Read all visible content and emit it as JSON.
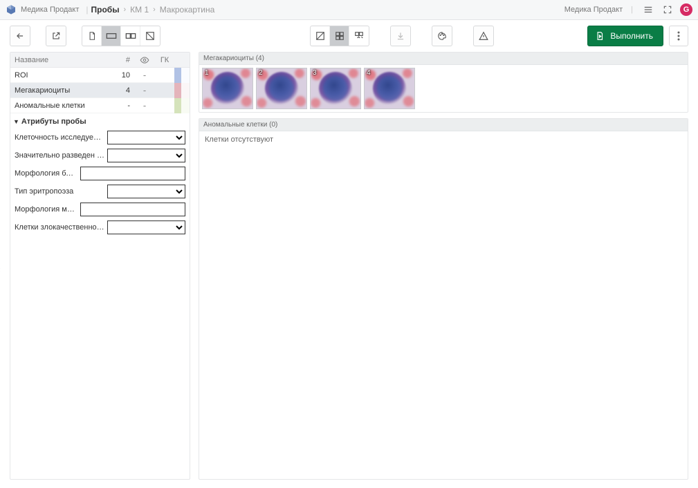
{
  "header": {
    "app_name": "Медика Продакт",
    "breadcrumb": [
      "Пробы",
      "КМ 1",
      "Макрокартина"
    ],
    "right_label": "Медика Продакт",
    "badge": "G"
  },
  "toolbar": {
    "run_label": "Выполнить"
  },
  "table": {
    "headers": {
      "name": "Название",
      "hash": "#",
      "gk": "ГК"
    },
    "rows": [
      {
        "name": "ROI",
        "count": "10",
        "eye": "-",
        "bar": "#b1c2e5",
        "swatch": "#fafbff"
      },
      {
        "name": "Мегакариоциты",
        "count": "4",
        "eye": "-",
        "bar": "#e4b4bb",
        "swatch": "#fbf6f7",
        "selected": true
      },
      {
        "name": "Аномальные клетки",
        "count": "-",
        "eye": "-",
        "bar": "#d5e3bb",
        "swatch": "#f8fbf3"
      }
    ]
  },
  "attributes": {
    "heading": "Атрибуты пробы",
    "rows": [
      {
        "label": "Клеточность исследуемого ...",
        "type": "select"
      },
      {
        "label": "Значительно разведен пери...",
        "type": "select"
      },
      {
        "label": "Морфология бластов",
        "type": "text"
      },
      {
        "label": "Тип эритропоэза",
        "type": "select"
      },
      {
        "label": "Морфология мегакариоцитов",
        "type": "text"
      },
      {
        "label": "Клетки злокачественного но...",
        "type": "select"
      }
    ]
  },
  "panels": [
    {
      "title": "Мегакариоциты (4)",
      "thumbs": [
        "1",
        "2",
        "3",
        "4"
      ]
    },
    {
      "title": "Аномальные клетки (0)",
      "empty_text": "Клетки отсутствуют"
    }
  ]
}
